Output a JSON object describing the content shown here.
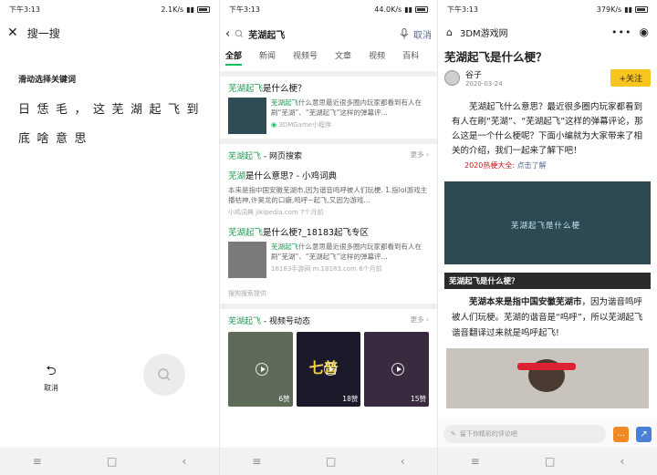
{
  "status": {
    "time": "下午3:13",
    "s1_speed": "2.1K/s",
    "s2_speed": "44.0K/s",
    "s3_speed": "379K/s"
  },
  "screen1": {
    "title": "搜一搜",
    "hint": "滑动选择关键词",
    "chars": [
      "日",
      "恁",
      "毛",
      "，",
      "这",
      "芜",
      "湖",
      "起",
      "飞",
      "到",
      "底",
      "啥",
      "意",
      "思"
    ],
    "cancel_label": "取消"
  },
  "screen2": {
    "query": "芜湖起飞",
    "cancel": "取消",
    "tabs": [
      "全部",
      "新闻",
      "视频号",
      "文章",
      "视频",
      "百科"
    ],
    "result1": {
      "title_hl": "芜湖起飞",
      "title_rest": "是什么梗？",
      "desc_hl": "芜湖起飞",
      "desc": "什么意思最近很多圈内玩家都看到有人在刷“芜湖”、“芜湖起飞”这样的弹幕评...",
      "source": "3DMGame小程序"
    },
    "web_section": {
      "hl": "芜湖起飞",
      "rest": " - 网页搜索",
      "more": "更多"
    },
    "result2": {
      "title_hl": "芜湖",
      "title_rest": "是什么意思? - 小鸡词典",
      "desc": "本来是指中国安徽芜湖市,因为谐音鸣呼被人们玩梗. 1.指lol游戏主播枯神,许昊龙的口癖,鸣呼~起飞,又因为游戏...",
      "source": "小鸡词典 jikipedia.com  7个月前"
    },
    "result3": {
      "title_hl": "芜湖起飞",
      "title_rest": "是什么梗?_18183起飞专区",
      "desc_hl": "芜湖起飞",
      "desc": "什么意思最近很多圈内玩家都看到有人在刷“芜湖”、“芜湖起飞”这样的弹幕评...",
      "source": "18183手游网 m.18183.com  6个月前"
    },
    "provider": "搜狗搜索提供",
    "video_section": {
      "hl": "芜湖起飞",
      "rest": " - 视频号动态",
      "more": "更多"
    },
    "videos": [
      {
        "likes": "6赞",
        "color": "#5d6b58"
      },
      {
        "likes": "18赞",
        "color": "#1a1a2a",
        "overlay": "七普"
      },
      {
        "likes": "15赞",
        "color": "#3a2a40"
      }
    ]
  },
  "screen3": {
    "site": "3DM游戏网",
    "title": "芜湖起飞是什么梗？",
    "author": "谷子",
    "date": "2020-03-24",
    "follow": "+关注",
    "intro": "芜湖起飞什么意思？最近很多圈内玩家都看到有人在刷“芜湖”、“芜湖起飞”这样的弹幕评论，那么这是一个什么梗呢？下面小编就为大家带来了相关的介绍，我们一起来了解下吧！",
    "hot_label": "2020热梗大全:",
    "hot_link": "点击了解",
    "banner_text": "芜湖起飞是什么梗",
    "subhead": "芜湖起飞是什么梗？",
    "para_bold": "芜湖本来是指中国安徽芜湖市",
    "para_rest": "，因为谐音鸣呼被人们玩梗。芜湖的谐音是“呜呼”，所以芜湖起飞谐音翻译过来就是呜呼起飞",
    "para_end": "!",
    "comment_placeholder": "留下你精彩的评论吧"
  },
  "nav": {
    "menu": "≡",
    "home": "□",
    "back": "‹"
  }
}
